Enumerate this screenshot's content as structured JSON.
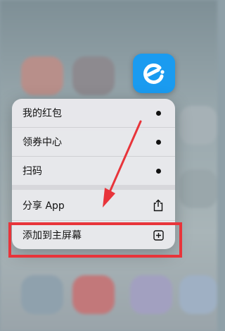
{
  "app": {
    "icon": "eleme-logo-icon",
    "accent": "#1a9bf0"
  },
  "menu": {
    "items": [
      {
        "label": "我的红包",
        "icon": "dot-icon"
      },
      {
        "label": "领券中心",
        "icon": "dot-icon"
      },
      {
        "label": "扫码",
        "icon": "dot-icon"
      },
      {
        "label": "分享 App",
        "icon": "share-icon"
      },
      {
        "label": "添加到主屏幕",
        "icon": "add-square-icon"
      }
    ]
  },
  "annotation": {
    "color": "#e8343a"
  }
}
